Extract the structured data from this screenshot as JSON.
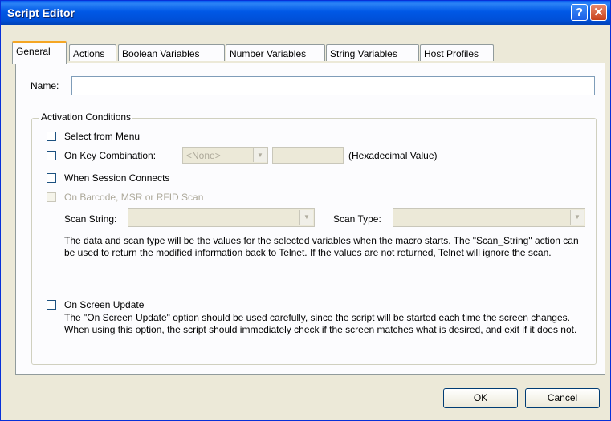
{
  "window": {
    "title": "Script Editor"
  },
  "titlebar": {
    "help_glyph": "?",
    "close_glyph": "✕"
  },
  "tabs": [
    {
      "label": "General",
      "active": true
    },
    {
      "label": "Actions",
      "active": false
    },
    {
      "label": "Boolean Variables",
      "active": false
    },
    {
      "label": "Number Variables",
      "active": false
    },
    {
      "label": "String Variables",
      "active": false
    },
    {
      "label": "Host Profiles",
      "active": false
    }
  ],
  "name": {
    "label": "Name:",
    "value": ""
  },
  "activation": {
    "group_label": "Activation Conditions",
    "select_from_menu": {
      "label": "Select from Menu",
      "checked": false
    },
    "key_combination": {
      "label": "On Key Combination:",
      "combo_value": "<None>",
      "hex_value": "",
      "hex_label": "(Hexadecimal Value)",
      "checked": false
    },
    "session_connects": {
      "label": "When Session Connects",
      "checked": false
    },
    "barcode_scan": {
      "label": "On Barcode, MSR or RFID Scan",
      "checked": false,
      "disabled": true
    },
    "scan_string": {
      "label": "Scan String:",
      "value": ""
    },
    "scan_type": {
      "label": "Scan Type:",
      "value": ""
    },
    "scan_description": "The data and scan type will be the values for the selected variables when the macro starts.  The \"Scan_String\" action can be used to return the modified information back to Telnet.  If the values are not returned, Telnet will ignore the scan.",
    "screen_update": {
      "label": "On Screen Update",
      "checked": false
    },
    "screen_update_description": "The \"On Screen Update\" option should be used carefully, since the script will be started each time the screen changes.  When using this option, the script should immediately check if the screen matches what is desired, and exit if it does not."
  },
  "buttons": {
    "ok": "OK",
    "cancel": "Cancel"
  },
  "icons": {
    "dropdown": "chevron-down-icon",
    "help": "help-icon",
    "close": "close-icon"
  },
  "colors": {
    "titlebar": "#0058e6",
    "dialog_bg": "#ece9d8",
    "tab_highlight": "#f5a623"
  }
}
